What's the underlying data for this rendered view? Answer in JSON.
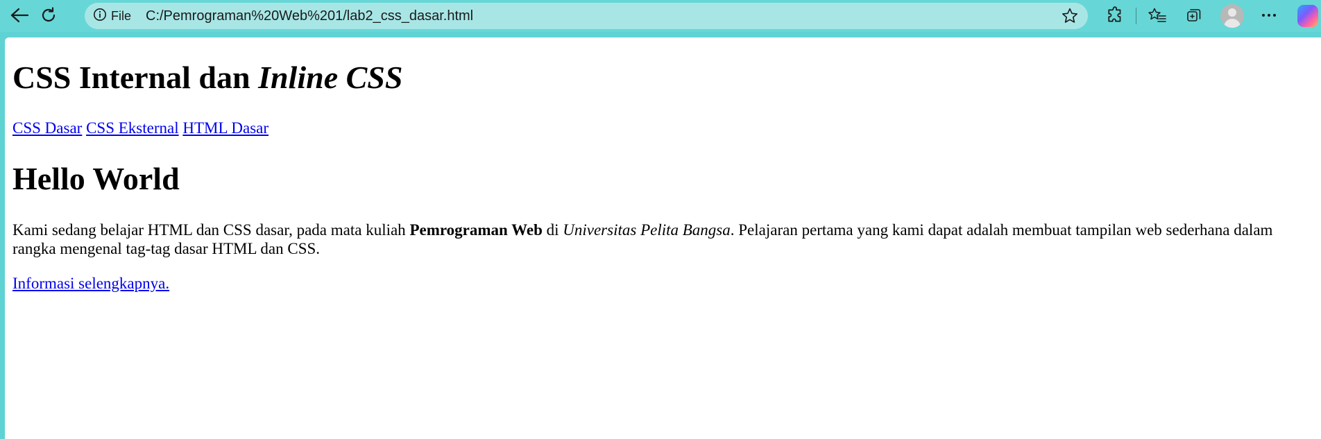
{
  "browser": {
    "site_info_label": "File",
    "url": "C:/Pemrograman%20Web%201/lab2_css_dasar.html",
    "icons": [
      "back-icon",
      "refresh-icon",
      "info-icon",
      "favorite-star-icon",
      "extensions-icon",
      "favorites-icon",
      "collections-icon",
      "profile-avatar",
      "more-icon",
      "copilot-icon"
    ]
  },
  "page": {
    "heading1_plain": "CSS Internal dan ",
    "heading1_italic": "Inline CSS",
    "nav_links": [
      "CSS Dasar",
      "CSS Eksternal",
      "HTML Dasar"
    ],
    "heading2": "Hello World",
    "paragraph": {
      "part1": "Kami sedang belajar HTML dan CSS dasar, pada mata kuliah ",
      "bold": "Pemrograman Web",
      "part2": " di ",
      "italic": "Universitas Pelita Bangsa",
      "part3": ". Pelajaran pertama yang kami dapat adalah membuat tampilan web sederhana dalam rangka mengenal tag-tag dasar HTML dan CSS."
    },
    "more_link": "Informasi selengkapnya."
  }
}
